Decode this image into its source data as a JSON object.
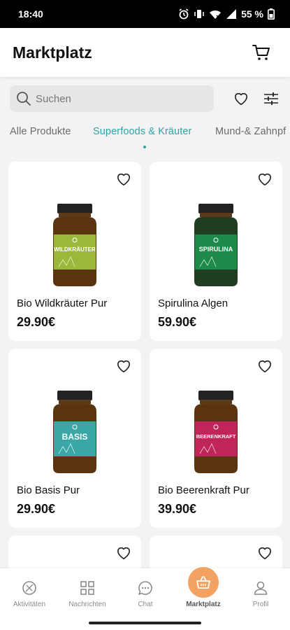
{
  "status": {
    "time": "18:40",
    "battery": "55 %"
  },
  "header": {
    "title": "Marktplatz"
  },
  "search": {
    "placeholder": "Suchen",
    "value": ""
  },
  "tabs": [
    {
      "label": "Alle Produkte",
      "active": false
    },
    {
      "label": "Superfoods & Kräuter",
      "active": true
    },
    {
      "label": "Mund-& Zahnpf",
      "active": false
    }
  ],
  "products": [
    {
      "name": "Bio Wildkräuter Pur",
      "price": "29.90€",
      "label_text": "WILDKRÄUTER",
      "label_color": "#9bb83a"
    },
    {
      "name": "Spirulina Algen",
      "price": "59.90€",
      "label_text": "SPIRULINA",
      "label_color": "#1e8a4a"
    },
    {
      "name": "Bio Basis Pur",
      "price": "29.90€",
      "label_text": "BASIS",
      "label_color": "#3aa6a6"
    },
    {
      "name": "Bio Beerenkraft Pur",
      "price": "39.90€",
      "label_text": "BEERENKRAFT",
      "label_color": "#c0245a"
    }
  ],
  "nav": [
    {
      "label": "Aktivitäten",
      "icon": "activity-icon"
    },
    {
      "label": "Nachrichten",
      "icon": "grid-icon"
    },
    {
      "label": "Chat",
      "icon": "chat-icon"
    },
    {
      "label": "Marktplatz",
      "icon": "basket-icon",
      "active": true
    },
    {
      "label": "Profil",
      "icon": "profile-icon"
    }
  ],
  "colors": {
    "accent": "#2aa6a6",
    "fab": "#f4a261"
  }
}
